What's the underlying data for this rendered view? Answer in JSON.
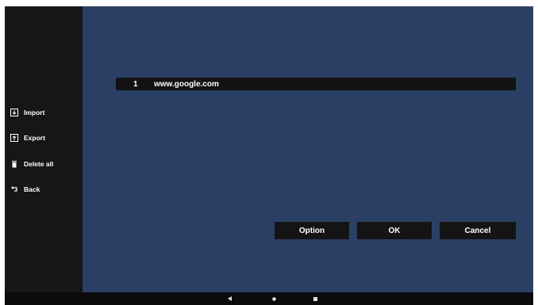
{
  "sidebar": {
    "items": [
      {
        "label": "Import",
        "icon": "import-icon"
      },
      {
        "label": "Export",
        "icon": "export-icon"
      },
      {
        "label": "Delete all",
        "icon": "trash-icon"
      },
      {
        "label": "Back",
        "icon": "back-arrow-icon"
      }
    ]
  },
  "list": {
    "rows": [
      {
        "index": "1",
        "url": "www.google.com"
      }
    ]
  },
  "buttons": {
    "option_label": "Option",
    "ok_label": "OK",
    "cancel_label": "Cancel"
  },
  "navbar": {
    "icons": [
      "back-nav-icon",
      "home-nav-icon",
      "recents-nav-icon"
    ]
  },
  "colors": {
    "content_background": "#2a3f63",
    "sidebar_background": "#161616",
    "button_background": "#141414",
    "text": "#ffffff"
  }
}
